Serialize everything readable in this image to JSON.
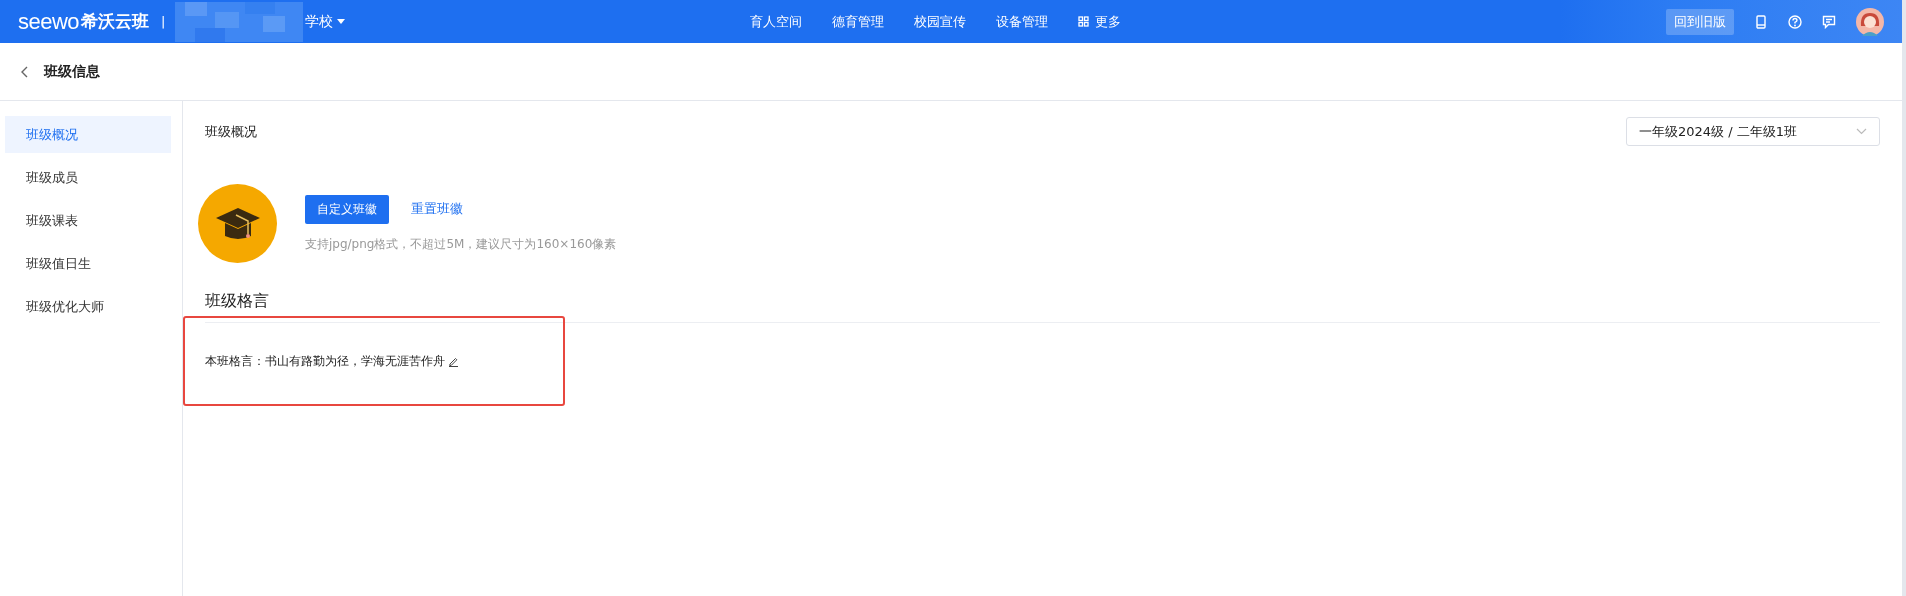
{
  "top_bar": {
    "logo_wordmark": "seewo",
    "logo_text": "希沃云班",
    "separator": "|",
    "school": "学校",
    "nav": [
      {
        "label": "育人空间",
        "kind": "text"
      },
      {
        "label": "德育管理",
        "kind": "text"
      },
      {
        "label": "校园宣传",
        "kind": "text"
      },
      {
        "label": "设备管理",
        "kind": "text"
      },
      {
        "label": "更多",
        "kind": "grid"
      }
    ],
    "old_version_button": "回到旧版"
  },
  "header": {
    "title": "班级信息"
  },
  "sidebar": {
    "items": [
      {
        "label": "班级概况",
        "selected": true
      },
      {
        "label": "班级成员",
        "selected": false
      },
      {
        "label": "班级课表",
        "selected": false
      },
      {
        "label": "班级值日生",
        "selected": false
      },
      {
        "label": "班级优化大师",
        "selected": false
      }
    ]
  },
  "content": {
    "title": "班级概况",
    "class_select": {
      "value": "一年级2024级 / 二年级1班"
    },
    "badge": {
      "custom_button": "自定义班徽",
      "reset_link": "重置班徽",
      "hint": "支持jpg/png格式，不超过5M，建议尺寸为160×160像素"
    },
    "motto_section": {
      "title": "班级格言",
      "label": "本班格言：",
      "motto": "书山有路勤为径，学海无涯苦作舟",
      "highlighted": true
    }
  }
}
